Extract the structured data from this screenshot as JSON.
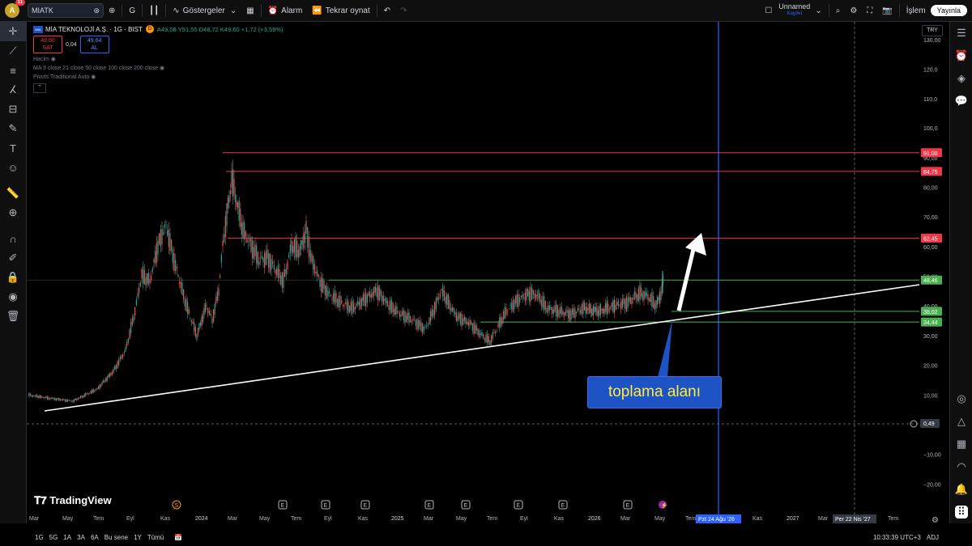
{
  "toolbar": {
    "avatar_letter": "A",
    "notification_count": "11",
    "symbol": "MIATK",
    "interval": "G",
    "indicators_label": "Göstergeler",
    "alert_label": "Alarm",
    "replay_label": "Tekrar oynat",
    "layout_name": "Unnamed",
    "layout_status": "Kaydet",
    "trade_label": "İşlem",
    "publish_label": "Yayınla"
  },
  "legend": {
    "symbol_title": "MİA TEKNOLOJİ A.Ş. · 1G · BIST",
    "badge": "D",
    "open": "A49,08",
    "high": "Y51,55",
    "low": "D48,72",
    "close": "K49,60",
    "change": "+1,72 (+3,59%)",
    "sell_price": "49,60",
    "sell_label": "SAT",
    "spread": "0,04",
    "buy_price": "49,64",
    "buy_label": "AL",
    "indicators": [
      "Hacim",
      "MA 9 close 21 close 50 close 100 close 200 close",
      "Pivots Traditional Auto"
    ]
  },
  "currency": "TRY",
  "annotation_text": "toplama alanı",
  "price_axis": [
    "130,00",
    "120,0",
    "110,0",
    "100,0",
    "90,00",
    "80,00",
    "70,00",
    "60,00",
    "50,00",
    "40,00",
    "30,00",
    "20,00",
    "10,00",
    "0,49",
    "−10,00",
    "−20,00"
  ],
  "price_labels": [
    {
      "value": "91,00",
      "color": "#f23645"
    },
    {
      "value": "84,75",
      "color": "#f23645"
    },
    {
      "value": "62,45",
      "color": "#f23645"
    },
    {
      "value": "48,46",
      "color": "#4caf50"
    },
    {
      "value": "38,02",
      "color": "#4caf50"
    },
    {
      "value": "34,44",
      "color": "#4caf50"
    }
  ],
  "time_axis": [
    "Mar",
    "May",
    "Tem",
    "Eyl",
    "Kas",
    "2024",
    "Mar",
    "May",
    "Tem",
    "Eyl",
    "Kas",
    "2025",
    "Mar",
    "May",
    "Tem",
    "Eyl",
    "Kas",
    "2026",
    "Mar",
    "May",
    "Tem",
    "Kas",
    "2027",
    "Mar",
    "Tem"
  ],
  "time_highlights": [
    "Pzt 24 Ağu '26",
    "Per 22 Nis '27"
  ],
  "logo_text": "TradingView",
  "bottombar": {
    "ranges": [
      "1G",
      "5G",
      "1A",
      "3A",
      "6A",
      "Bu sene",
      "1Y",
      "Tümü"
    ],
    "clock": "10:33:39 UTC+3",
    "adj": "ADJ"
  },
  "colors": {
    "resistance": "#f23645",
    "support": "#4caf50",
    "crosshair": "#2962ff",
    "up": "#26a69a",
    "down": "#ef5350"
  }
}
